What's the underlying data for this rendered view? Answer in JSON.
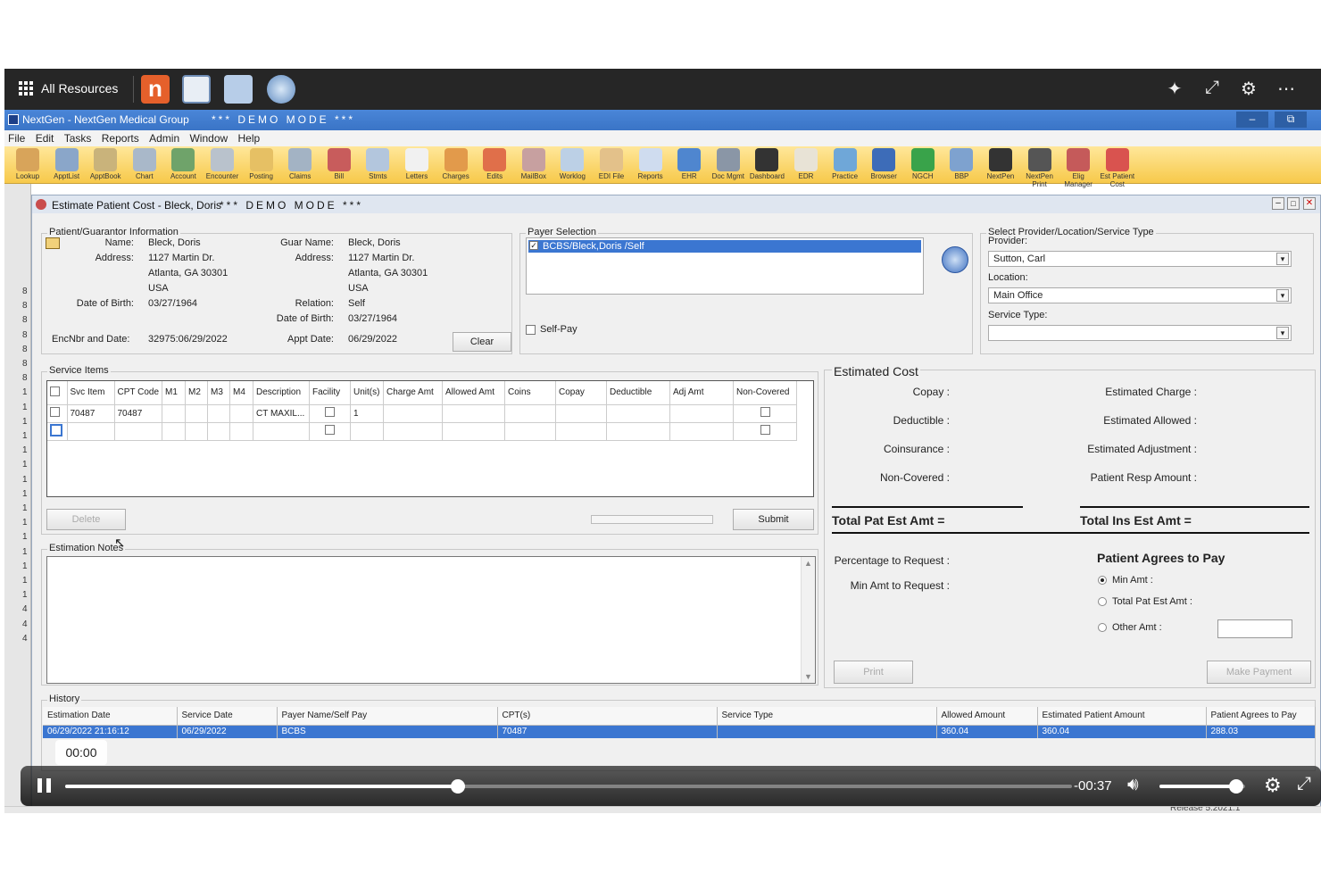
{
  "top_bar": {
    "all_resources": "All Resources"
  },
  "window": {
    "title": "NextGen - NextGen Medical Group",
    "demo": "*** DEMO MODE ***"
  },
  "menu": [
    "File",
    "Edit",
    "Tasks",
    "Reports",
    "Admin",
    "Window",
    "Help"
  ],
  "toolbar": [
    "Lookup",
    "ApptList",
    "ApptBook",
    "Chart",
    "Account",
    "Encounter",
    "Posting",
    "Claims",
    "Bill",
    "Stmts",
    "Letters",
    "Charges",
    "Edits",
    "MailBox",
    "Worklog",
    "EDI File",
    "Reports",
    "EHR",
    "Doc Mgmt",
    "Dashboard",
    "EDR",
    "Practice",
    "Browser",
    "NGCH",
    "BBP",
    "NextPen",
    "NextPen Print",
    "Elig Manager",
    "Est Patient Cost"
  ],
  "left_strip_digits": [
    "8",
    "8",
    "8",
    "8",
    "8",
    "8",
    "8",
    "1",
    "1",
    "1",
    "1",
    "1",
    "1",
    "1",
    "1",
    "1",
    "1",
    "1",
    "1",
    "1",
    "1",
    "1",
    "4",
    "4",
    "4"
  ],
  "child": {
    "title": "Estimate Patient Cost - Bleck, Doris",
    "demo": "*** DEMO MODE ***"
  },
  "patient": {
    "legend": "Patient/Guarantor Information",
    "name_label": "Name:",
    "name": "Bleck, Doris",
    "address_label": "Address:",
    "address1": "1127 Martin Dr.",
    "address2": "Atlanta, GA 30301",
    "address3": "USA",
    "dob_label": "Date of Birth:",
    "dob": "03/27/1964",
    "guar_name_label": "Guar Name:",
    "guar_name": "Bleck, Doris",
    "guar_address_label": "Address:",
    "guar_address1": "1127 Martin Dr.",
    "guar_address2": "Atlanta, GA 30301",
    "guar_address3": "USA",
    "relation_label": "Relation:",
    "relation": "Self",
    "guar_dob_label": "Date of Birth:",
    "guar_dob": "03/27/1964",
    "enc_label": "EncNbr and Date:",
    "enc": "32975:06/29/2022",
    "appt_label": "Appt Date:",
    "appt": "06/29/2022",
    "clear": "Clear"
  },
  "payer": {
    "legend": "Payer Selection",
    "item": "BCBS/Bleck,Doris /Self",
    "self_pay": "Self-Pay"
  },
  "provider": {
    "legend": "Select Provider/Location/Service Type",
    "provider_label": "Provider:",
    "provider": "Sutton, Carl",
    "location_label": "Location:",
    "location": "Main Office",
    "service_type_label": "Service Type:",
    "service_type": ""
  },
  "service_items": {
    "legend": "Service Items",
    "headers": [
      "Svc Item",
      "CPT Code",
      "M1",
      "M2",
      "M3",
      "M4",
      "Description",
      "Facility",
      "Unit(s)",
      "Charge Amt",
      "Allowed Amt",
      "Coins",
      "Copay",
      "Deductible",
      "Adj Amt",
      "Non-Covered"
    ],
    "row": {
      "svc": "70487",
      "cpt": "70487",
      "desc": "CT MAXIL...",
      "units": "1"
    },
    "delete": "Delete",
    "submit": "Submit"
  },
  "notes": {
    "legend": "Estimation Notes"
  },
  "estimated": {
    "title": "Estimated Cost",
    "copay": "Copay :",
    "deductible": "Deductible :",
    "coinsurance": "Coinsurance :",
    "noncovered": "Non-Covered :",
    "est_charge": "Estimated Charge :",
    "est_allowed": "Estimated Allowed :",
    "est_adjust": "Estimated Adjustment :",
    "pat_resp": "Patient Resp Amount :",
    "total_pat": "Total Pat Est Amt =",
    "total_ins": "Total Ins Est Amt =",
    "pct_request": "Percentage to Request :",
    "min_request": "Min Amt to Request :",
    "agrees_title": "Patient Agrees to Pay",
    "min_amt": "Min Amt :",
    "total_pat_amt": "Total Pat Est Amt :",
    "other_amt": "Other Amt :",
    "print": "Print",
    "make_payment": "Make Payment"
  },
  "history": {
    "legend": "History",
    "headers": [
      "Estimation Date",
      "Service Date",
      "Payer Name/Self Pay",
      "CPT(s)",
      "Service Type",
      "Allowed Amount",
      "Estimated Patient Amount",
      "Patient Agrees to Pay"
    ],
    "row": [
      "06/29/2022 21:16:12",
      "06/29/2022",
      "BCBS",
      "70487",
      "",
      "360.04",
      "360.04",
      "288.03"
    ]
  },
  "status_bar": {
    "release": "Release 5.2021.1"
  },
  "video": {
    "current": "00:00",
    "remaining": "-00:37",
    "progress": 0.39,
    "volume": 0.9
  }
}
